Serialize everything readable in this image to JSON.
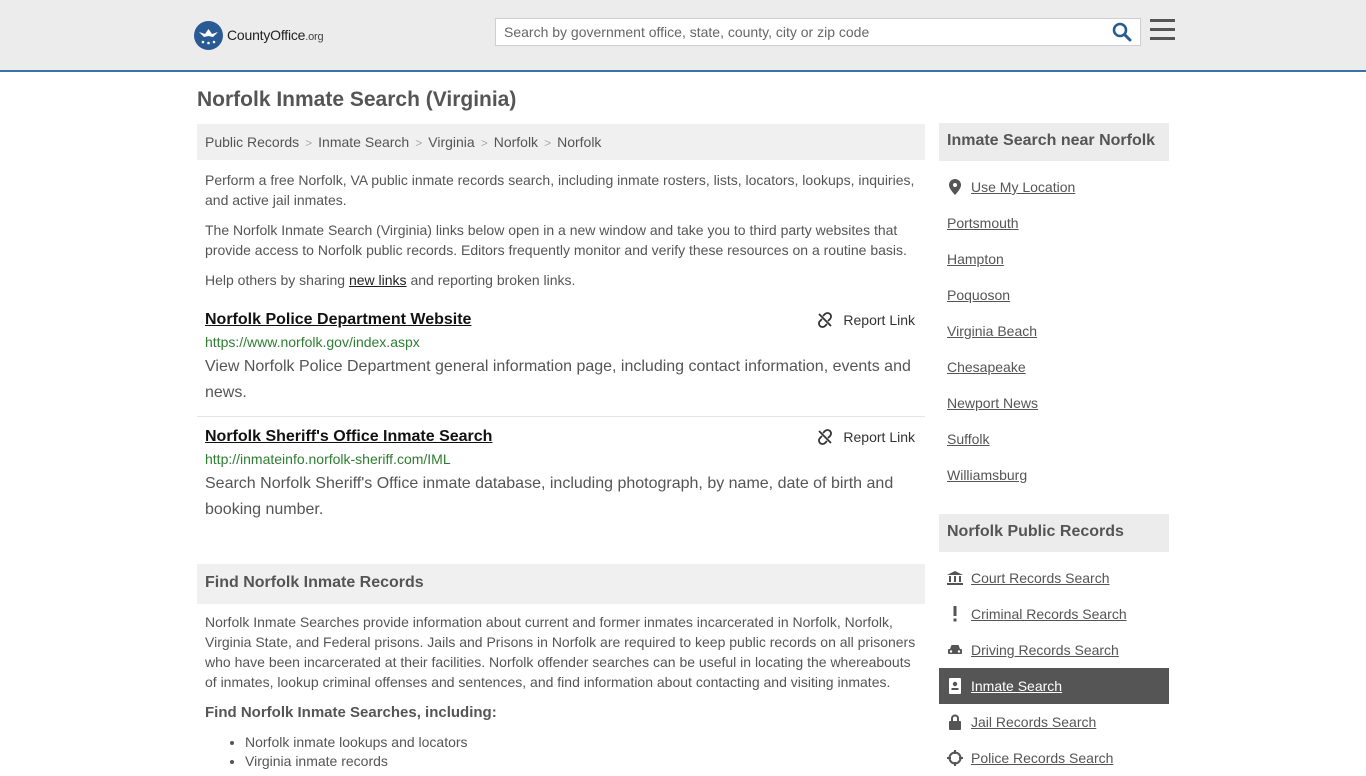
{
  "header": {
    "logo_name": "CountyOffice",
    "logo_tld": ".org",
    "search_placeholder": "Search by government office, state, county, city or zip code"
  },
  "page_title": "Norfolk Inmate Search (Virginia)",
  "breadcrumb": [
    "Public Records",
    "Inmate Search",
    "Virginia",
    "Norfolk",
    "Norfolk"
  ],
  "intro": {
    "p1": "Perform a free Norfolk, VA public inmate records search, including inmate rosters, lists, locators, lookups, inquiries, and active jail inmates.",
    "p2": "The Norfolk Inmate Search (Virginia) links below open in a new window and take you to third party websites that provide access to Norfolk public records. Editors frequently monitor and verify these resources on a routine basis.",
    "p3_before": "Help others by sharing ",
    "p3_link": "new links",
    "p3_after": " and reporting broken links."
  },
  "links": [
    {
      "title": "Norfolk Police Department Website",
      "url": "https://www.norfolk.gov/index.aspx",
      "description": "View Norfolk Police Department general information page, including contact information, events and news.",
      "report": "Report Link"
    },
    {
      "title": "Norfolk Sheriff's Office Inmate Search",
      "url": "http://inmateinfo.norfolk-sheriff.com/IML",
      "description": "Search Norfolk Sheriff's Office inmate database, including photograph, by name, date of birth and booking number.",
      "report": "Report Link"
    }
  ],
  "find_section": {
    "heading": "Find Norfolk Inmate Records",
    "body": "Norfolk Inmate Searches provide information about current and former inmates incarcerated in Norfolk, Norfolk, Virginia State, and Federal prisons. Jails and Prisons in Norfolk are required to keep public records on all prisoners who have been incarcerated at their facilities. Norfolk offender searches can be useful in locating the whereabouts of inmates, lookup criminal offenses and sentences, and find information about contacting and visiting inmates.",
    "subheading": "Find Norfolk Inmate Searches, including:",
    "bullets": [
      "Norfolk inmate lookups and locators",
      "Virginia inmate records"
    ]
  },
  "sidebar": {
    "nearby_heading": "Inmate Search near Norfolk",
    "use_location": "Use My Location",
    "nearby": [
      "Portsmouth",
      "Hampton",
      "Poquoson",
      "Virginia Beach",
      "Chesapeake",
      "Newport News",
      "Suffolk",
      "Williamsburg"
    ],
    "records_heading": "Norfolk Public Records",
    "records": [
      {
        "label": "Court Records Search",
        "icon": "courthouse-icon"
      },
      {
        "label": "Criminal Records Search",
        "icon": "exclamation-icon"
      },
      {
        "label": "Driving Records Search",
        "icon": "car-icon"
      },
      {
        "label": "Inmate Search",
        "icon": "id-card-icon",
        "active": true
      },
      {
        "label": "Jail Records Search",
        "icon": "lock-icon"
      },
      {
        "label": "Police Records Search",
        "icon": "crosshair-icon"
      }
    ]
  },
  "colors": {
    "header_bg": "#ececec",
    "header_border": "#3b72a8",
    "url_green": "#2e7d32",
    "active_bg": "#555555",
    "search_icon": "#2a5a94"
  }
}
